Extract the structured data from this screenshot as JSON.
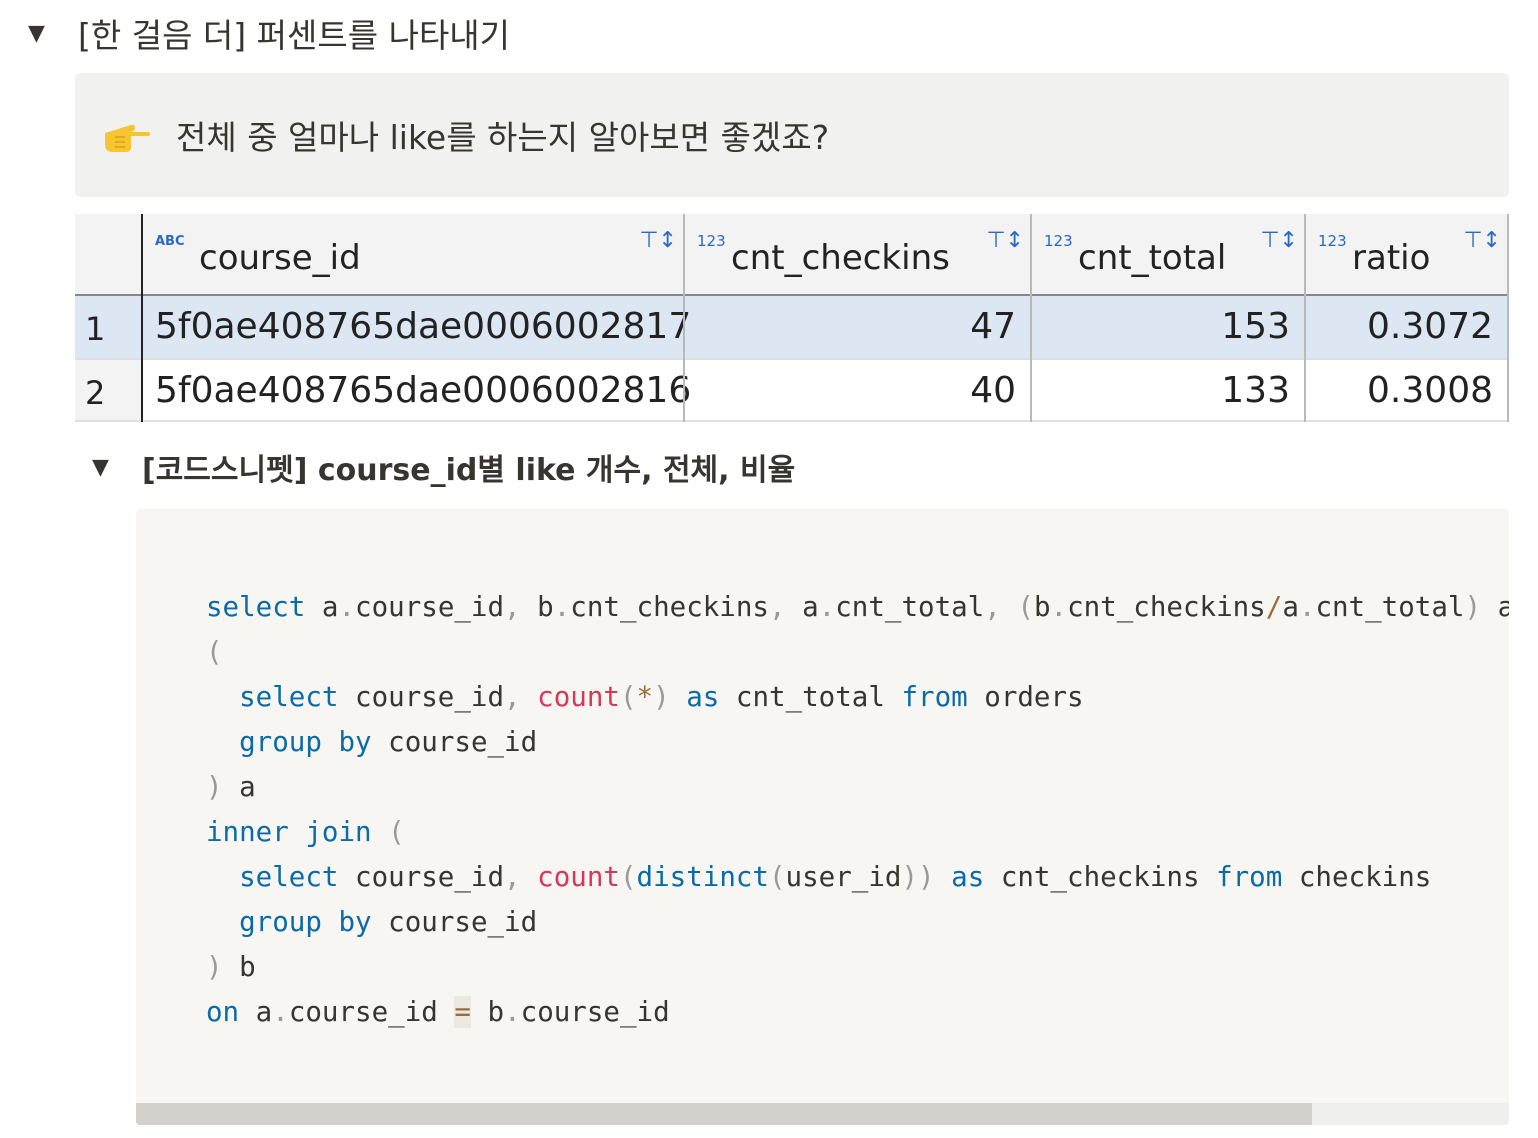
{
  "toggle1": {
    "title": "[한 걸음 더] 퍼센트를 나타내기"
  },
  "callout": {
    "icon": "pointing-hand-icon",
    "text": "전체 중 얼마나 like를 하는지 알아보면 좋겠죠?"
  },
  "grid": {
    "columns": [
      {
        "type_tag": "ABC",
        "name": "course_id"
      },
      {
        "type_tag": "123",
        "name": "cnt_checkins"
      },
      {
        "type_tag": "123",
        "name": "cnt_total"
      },
      {
        "type_tag": "123",
        "name": "ratio"
      }
    ],
    "rows": [
      {
        "num": "1",
        "course_id": "5f0ae408765dae0006002817",
        "cnt_checkins": "47",
        "cnt_total": "153",
        "ratio": "0.3072"
      },
      {
        "num": "2",
        "course_id": "5f0ae408765dae0006002816",
        "cnt_checkins": "40",
        "cnt_total": "133",
        "ratio": "0.3008"
      }
    ],
    "colors": {
      "selected_row": "#dde6f3",
      "header_bg": "#f3f3f3",
      "type_icon": "#2a68c8"
    }
  },
  "toggle2": {
    "title": "[코드스니펫] course_id별 like 개수, 전체, 비율"
  },
  "code": {
    "lines": [
      "select a.course_id, b.cnt_checkins, a.cnt_total, (b.cnt_checkins/a.cnt_total) a",
      "(",
      "  select course_id, count(*) as cnt_total from orders",
      "  group by course_id",
      ") a",
      "inner join (",
      "  select course_id, count(distinct(user_id)) as cnt_checkins from checkins",
      "  group by course_id",
      ") b",
      "on a.course_id = b.course_id"
    ]
  }
}
